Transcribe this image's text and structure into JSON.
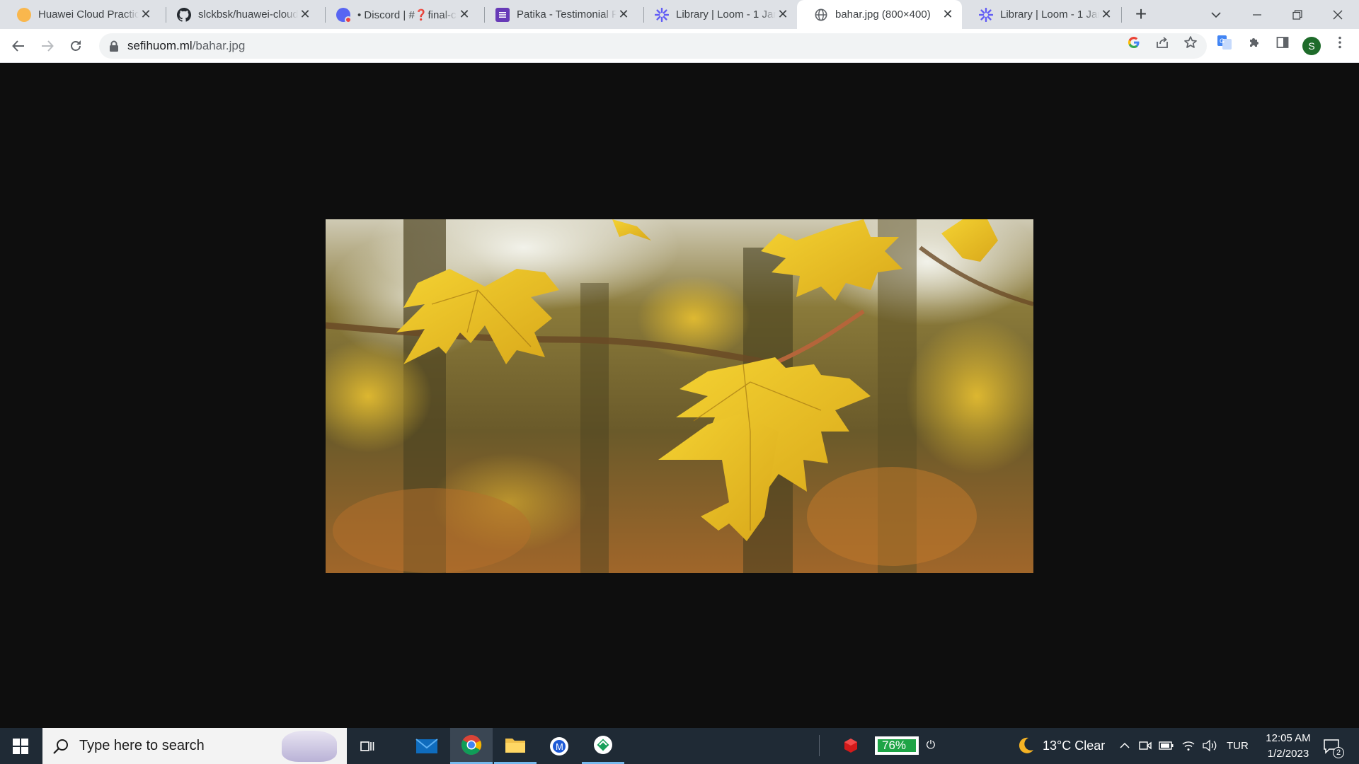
{
  "tabs": [
    {
      "title": "Huawei Cloud Practice",
      "favicon": "huawei-orange-dot-icon"
    },
    {
      "title": "slckbsk/huawei-cloud",
      "favicon": "github-icon"
    },
    {
      "title": "• Discord | #❓final-ca",
      "favicon": "discord-icon"
    },
    {
      "title": "Patika - Testimonial Fo",
      "favicon": "forms-icon"
    },
    {
      "title": "Library | Loom - 1 Jan",
      "favicon": "loom-icon"
    },
    {
      "title": "bahar.jpg (800×400)",
      "favicon": "globe-icon"
    },
    {
      "title": "Library | Loom - 1 Jan",
      "favicon": "loom-icon"
    }
  ],
  "address_bar": {
    "domain": "sefihuom.ml",
    "path": "/bahar.jpg"
  },
  "profile_initial": "S",
  "taskbar": {
    "search_placeholder": "Type here to search",
    "battery_percent": "76%",
    "weather": "13°C  Clear",
    "language": "TUR",
    "time": "12:05 AM",
    "date": "1/2/2023",
    "notifications": "2"
  },
  "colors": {
    "chrome_bg": "#dee1e6",
    "taskbar_bg": "#1f2a35",
    "battery_green": "#1ea446"
  }
}
